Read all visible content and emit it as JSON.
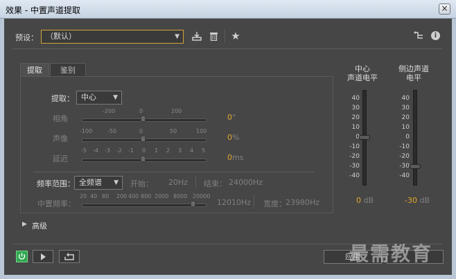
{
  "window": {
    "title": "效果 - 中置声道提取",
    "close_glyph": "×"
  },
  "preset": {
    "label": "预设：",
    "value": "（默认）"
  },
  "tabs": [
    {
      "label": "提取"
    },
    {
      "label": "鉴别"
    }
  ],
  "extract": {
    "label": "提取：",
    "value": "中心",
    "phase": {
      "label": "相角",
      "ticks": [
        "-200",
        "0",
        "200"
      ],
      "value": "0",
      "unit": "°"
    },
    "pan": {
      "label": "声像",
      "ticks": [
        "-100",
        "-50",
        "0",
        "50",
        "100"
      ],
      "value": "0",
      "unit": "%"
    },
    "delay": {
      "label": "延迟",
      "ticks": [
        "-5",
        "-4",
        "-3",
        "-2",
        "-1",
        "0",
        "1",
        "2",
        "3",
        "4",
        "5"
      ],
      "value": "0",
      "unit": "ms"
    }
  },
  "frequency": {
    "range_label": "频率范围：",
    "range_value": "全频谱",
    "start_label": "开始：",
    "start_value": "20",
    "start_unit": "Hz",
    "end_label": "结束：",
    "end_value": "24000",
    "end_unit": "Hz",
    "center_label": "中置频率：",
    "center_ticks": [
      "20",
      "40",
      "80",
      "200",
      "400",
      "800",
      "2000",
      "8000",
      "20000"
    ],
    "center_value": "12010",
    "center_unit": "Hz",
    "width_label": "宽度：",
    "width_value": "23980",
    "width_unit": "Hz"
  },
  "advanced": {
    "label": "高级"
  },
  "meters": {
    "scale": [
      "40",
      "30",
      "20",
      "10",
      "0",
      "-10",
      "-20",
      "-30",
      "-40"
    ],
    "center": {
      "title_line1": "中心",
      "title_line2": "声道电平",
      "value": "0",
      "unit": "dB",
      "level_db": 0
    },
    "side": {
      "title_line1": "侧边声道",
      "title_line2": "电平",
      "value": "-30",
      "unit": "dB",
      "level_db": -30
    }
  },
  "footer": {
    "apply_label": "应用",
    "watermark": "最需教育"
  },
  "icons": {
    "save": "download-icon",
    "delete": "trash-icon",
    "favorite": "star-icon",
    "routing": "routing-icon",
    "info": "info-icon",
    "power": "power-icon",
    "play": "play-icon",
    "loop": "loop-icon",
    "expand": "triangle-right-icon"
  },
  "colors": {
    "accent": "#e6a92c",
    "power_on": "#2fa84f"
  }
}
